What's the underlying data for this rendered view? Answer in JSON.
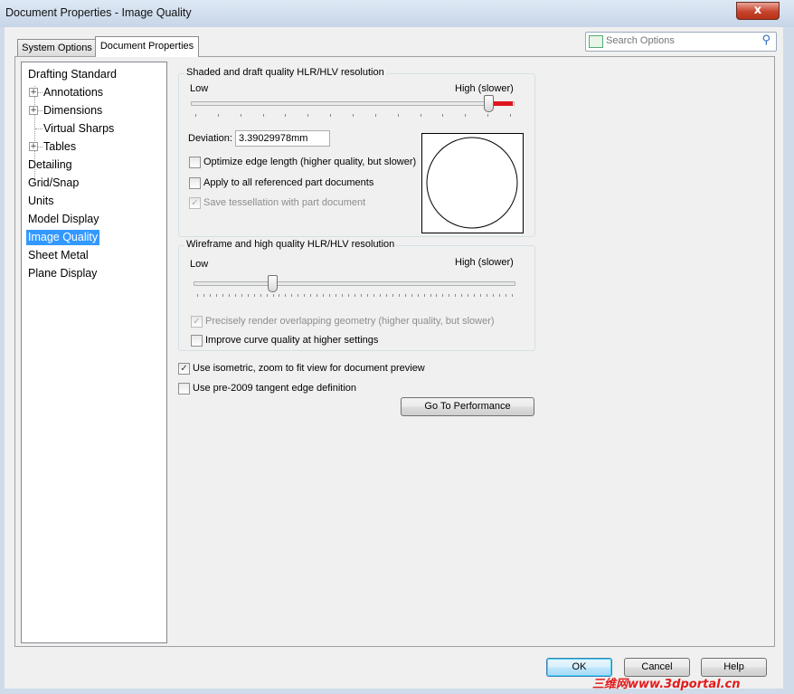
{
  "window": {
    "title": "Document Properties - Image Quality",
    "close_glyph": "x"
  },
  "tabs": [
    {
      "label": "System Options",
      "active": false
    },
    {
      "label": "Document Properties",
      "active": true
    }
  ],
  "search": {
    "placeholder": "Search Options"
  },
  "nav": {
    "items": [
      {
        "label": "Drafting Standard"
      },
      {
        "label": "Annotations",
        "expandable": true
      },
      {
        "label": "Dimensions",
        "expandable": true
      },
      {
        "label": "Virtual Sharps"
      },
      {
        "label": "Tables",
        "expandable": true
      },
      {
        "label": "Detailing"
      },
      {
        "label": "Grid/Snap"
      },
      {
        "label": "Units"
      },
      {
        "label": "Model Display"
      },
      {
        "label": "Image Quality",
        "selected": true
      },
      {
        "label": "Sheet Metal"
      },
      {
        "label": "Plane Display"
      }
    ]
  },
  "shaded": {
    "title": "Shaded and draft quality HLR/HLV resolution",
    "low": "Low",
    "high": "High (slower)",
    "slider_level": 0.93,
    "deviation_label": "Deviation:",
    "deviation_value": "3.39029978mm",
    "optimize": {
      "label": "Optimize edge length (higher quality, but slower)",
      "checked": false
    },
    "apply_all": {
      "label": "Apply to all referenced part documents",
      "checked": false
    },
    "save_tess": {
      "label": "Save tessellation with part document",
      "checked": true,
      "disabled": true
    }
  },
  "wireframe": {
    "title": "Wireframe and high quality HLR/HLV resolution",
    "low": "Low",
    "high": "High (slower)",
    "slider_level": 0.25,
    "precisely": {
      "label": "Precisely render overlapping geometry (higher quality, but slower)",
      "checked": true,
      "disabled": true
    },
    "improve": {
      "label": "Improve curve quality at higher settings",
      "checked": false
    }
  },
  "isometric": {
    "label": "Use isometric, zoom to fit view for document preview",
    "checked": true
  },
  "pre2009": {
    "label": "Use pre-2009 tangent edge definition",
    "checked": false
  },
  "buttons": {
    "performance": "Go To Performance",
    "ok": "OK",
    "cancel": "Cancel",
    "help": "Help"
  },
  "glyphs": {
    "check": "✓",
    "plus": "+"
  },
  "watermark": "三维网www.3dportal.cn",
  "colors": {
    "selection": "#3399ff",
    "slider_fill": "#e0141e",
    "close_button": "#c7432c"
  }
}
